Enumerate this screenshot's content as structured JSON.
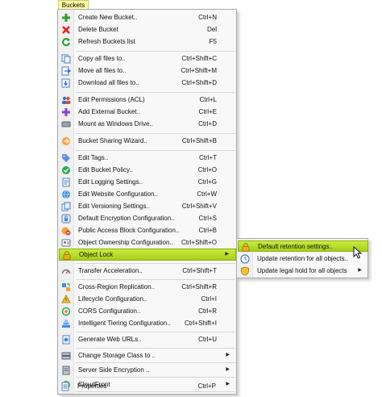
{
  "menubar": {
    "active_tab": "Buckets"
  },
  "menu_items": [
    {
      "label": "Create New Bucket..",
      "shortcut": "Ctrl+N",
      "icon": "plus-icon"
    },
    {
      "label": "Delete Bucket",
      "shortcut": "Del",
      "icon": "delete-x-icon"
    },
    {
      "label": "Refresh Buckets list",
      "shortcut": "F5",
      "icon": "refresh-icon"
    },
    {
      "label": "Copy all files to..",
      "shortcut": "Ctrl+Shift+C",
      "icon": "copy-files-icon"
    },
    {
      "label": "Move all files to..",
      "shortcut": "Ctrl+Shift+M",
      "icon": "move-files-icon"
    },
    {
      "label": "Download all files to..",
      "shortcut": "Ctrl+Shift+D",
      "icon": "download-icon"
    },
    {
      "label": "Edit Permissions (ACL)",
      "shortcut": "Ctrl+L",
      "icon": "users-icon"
    },
    {
      "label": "Add External Bucket..",
      "shortcut": "Ctrl+E",
      "icon": "add-external-icon"
    },
    {
      "label": "Mount as Windows Drive..",
      "shortcut": "Ctrl+D",
      "icon": "drive-icon"
    },
    {
      "label": "Bucket Sharing Wizard..",
      "shortcut": "Ctrl+Shift+B",
      "icon": "sharing-icon"
    },
    {
      "label": "Edit Tags..",
      "shortcut": "Ctrl+T",
      "icon": "tag-icon"
    },
    {
      "label": "Edit Bucket Policy..",
      "shortcut": "Ctrl+O",
      "icon": "policy-icon"
    },
    {
      "label": "Edit Logging Settings..",
      "shortcut": "Ctrl+G",
      "icon": "logging-icon"
    },
    {
      "label": "Edit Website Configuration..",
      "shortcut": "Ctrl+W",
      "icon": "globe-icon"
    },
    {
      "label": "Edit Versioning Settings..",
      "shortcut": "Ctrl+Shift+V",
      "icon": "versioning-icon"
    },
    {
      "label": "Default Encryption Configuration..",
      "shortcut": "Ctrl+S",
      "icon": "encryption-icon"
    },
    {
      "label": "Public Access Block Configuration..",
      "shortcut": "Ctrl+B",
      "icon": "public-block-icon"
    },
    {
      "label": "Object Ownership Configuration..",
      "shortcut": "Ctrl+Shift+O",
      "icon": "ownership-icon"
    },
    {
      "label": "Object Lock",
      "shortcut": "",
      "icon": "lock-icon"
    },
    {
      "label": "Transfer Acceleration..",
      "shortcut": "Ctrl+Shift+T",
      "icon": "acceleration-icon"
    },
    {
      "label": "Cross-Region Replication..",
      "shortcut": "Ctrl+Shift+R",
      "icon": "replication-icon"
    },
    {
      "label": "Lifecycle Configuration..",
      "shortcut": "Ctrl+I",
      "icon": "lifecycle-icon"
    },
    {
      "label": "CORS Configuration..",
      "shortcut": "Ctrl+R",
      "icon": "cors-icon"
    },
    {
      "label": "Intelligent Tiering Configuration..",
      "shortcut": "Ctrl+Shift+I",
      "icon": "tiering-icon"
    },
    {
      "label": "Generate Web URLs..",
      "shortcut": "Ctrl+U",
      "icon": "web-url-icon"
    },
    {
      "label": "Change Storage Class to ..",
      "shortcut": "",
      "icon": "storage-class-icon"
    },
    {
      "label": "Server Side Encryption ..",
      "shortcut": "",
      "icon": "server-encryption-icon"
    },
    {
      "label": "CloudFront",
      "shortcut": "",
      "icon": "cloudfront-icon"
    },
    {
      "label": "Properties",
      "shortcut": "Ctrl+P",
      "icon": "properties-icon"
    }
  ],
  "submenu_items": [
    {
      "label": "Default retention settings..",
      "icon": "retention-lock-icon"
    },
    {
      "label": "Update retention for all objects..",
      "icon": "clock-icon"
    },
    {
      "label": "Update legal hold for all objects",
      "icon": "shield-icon"
    }
  ],
  "colors": {
    "highlight": "#b5dc2a",
    "menubar_tab": "#ffff9c"
  }
}
